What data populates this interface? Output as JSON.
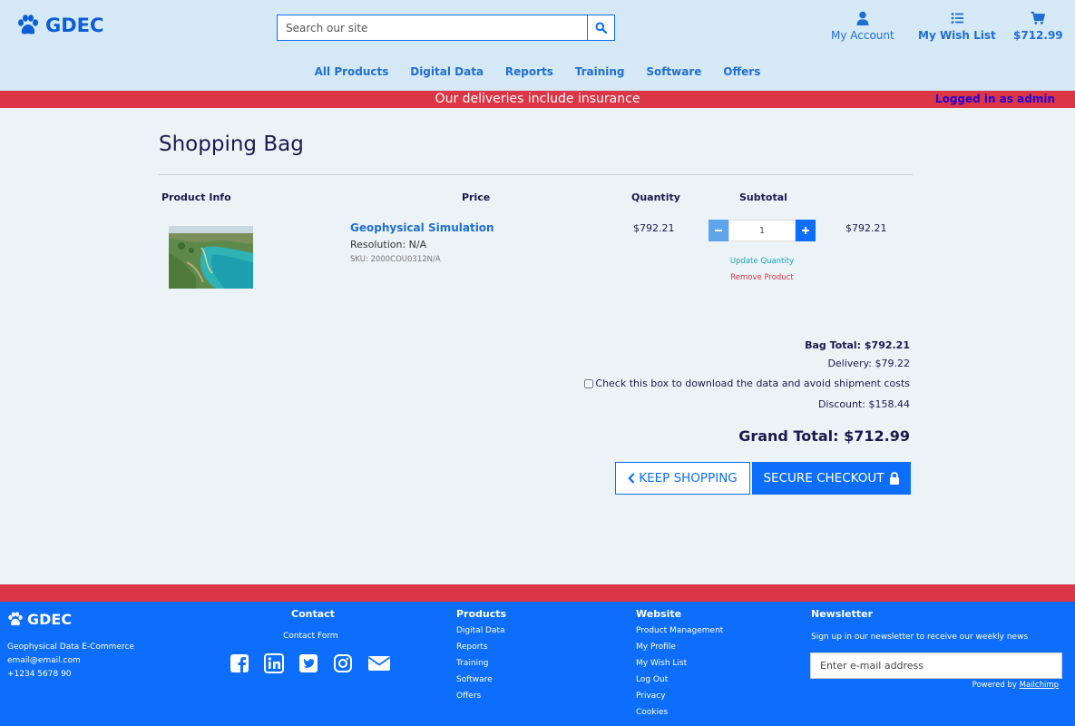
{
  "header": {
    "brand": "GDEC",
    "search": {
      "placeholder": "Search our site",
      "value": ""
    },
    "account_label": "My Account",
    "wishlist_label": "My Wish List",
    "cart_total": "$712.99"
  },
  "nav": [
    "All Products",
    "Digital Data",
    "Reports",
    "Training",
    "Software",
    "Offers"
  ],
  "banner": {
    "message": "Our deliveries include insurance",
    "login_status": "Logged in as admin"
  },
  "bag": {
    "title": "Shopping Bag",
    "columns": [
      "Product Info",
      "Price",
      "Quantity",
      "Subtotal"
    ],
    "items": [
      {
        "name": "Geophysical Simulation",
        "resolution": "Resolution: N/A",
        "sku": "SKU: 2000COU0312N/A",
        "price": "$792.21",
        "quantity": "1",
        "subtotal": "$792.21",
        "update_label": "Update Quantity",
        "remove_label": "Remove Product"
      }
    ],
    "bag_total": "Bag Total: $792.21",
    "delivery": "Delivery: $79.22",
    "download_checkbox_label": "Check this box to download the data and avoid shipment costs",
    "download_checked": false,
    "discount": "Discount: $158.44",
    "grand_total": "Grand Total: $712.99",
    "keep_shopping_label": "KEEP SHOPPING",
    "checkout_label": "SECURE CHECKOUT"
  },
  "footer": {
    "brand": "GDEC",
    "company": "Geophysical Data E-Commerce",
    "email": "email@email.com",
    "phone": "+1234 5678 90",
    "contact": {
      "heading": "Contact",
      "link": "Contact Form"
    },
    "products": {
      "heading": "Products",
      "links": [
        "Digital Data",
        "Reports",
        "Training",
        "Software",
        "Offers"
      ]
    },
    "website": {
      "heading": "Website",
      "links": [
        "Product Management",
        "My Profile",
        "My Wish List",
        "Log Out",
        "Privacy",
        "Cookies"
      ]
    },
    "newsletter": {
      "heading": "Newsletter",
      "text": "Sign up in our newsletter to receive our weekly news",
      "placeholder": "Enter e-mail address",
      "powered_prefix": "Powered by ",
      "powered_link": "Mailchimp"
    }
  },
  "colors": {
    "primary": "#0d6efd",
    "danger": "#dc3545",
    "header_bg": "#d4e8f6",
    "page_bg": "#ebf3f7",
    "navy": "#1a1a4d"
  }
}
